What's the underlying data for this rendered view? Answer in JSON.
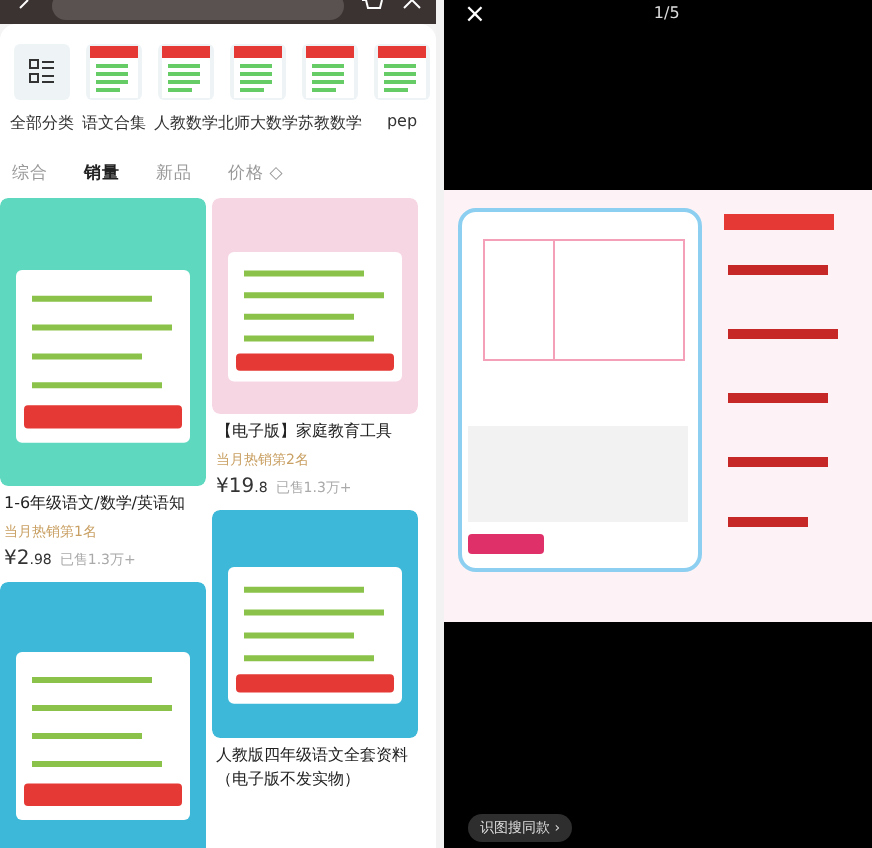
{
  "categories": [
    {
      "label": "全部分类",
      "kind": "all"
    },
    {
      "label": "语文合集",
      "kind": "thumb"
    },
    {
      "label": "人教数学",
      "kind": "thumb"
    },
    {
      "label": "北师大数学",
      "kind": "thumb"
    },
    {
      "label": "苏教数学",
      "kind": "thumb"
    },
    {
      "label": "pep",
      "kind": "thumb"
    }
  ],
  "sort_tabs": [
    {
      "label": "综合",
      "selected": false
    },
    {
      "label": "销量",
      "selected": true
    },
    {
      "label": "新品",
      "selected": false
    },
    {
      "label": "价格",
      "selected": false,
      "icon": "◇"
    }
  ],
  "products_left": [
    {
      "title": "1-6年级语文/数学/英语知",
      "rank": "当月热销第1名",
      "price": "¥2",
      "price_decimal": ".98",
      "sold": "已售1.3万+",
      "kind": "listing"
    },
    {
      "kind": "image_only"
    }
  ],
  "products_right": [
    {
      "title": "【电子版】家庭教育工具",
      "rank": "当月热销第2名",
      "price": "¥19",
      "price_decimal": ".8",
      "sold": "已售1.3万+",
      "kind": "listing"
    },
    {
      "kind": "listing",
      "title": "人教版四年级语文全套资料（电子版不发实物）"
    }
  ],
  "viewer": {
    "counter": "1/5",
    "close": "×",
    "find_similar": "识图搜同款 ›"
  }
}
